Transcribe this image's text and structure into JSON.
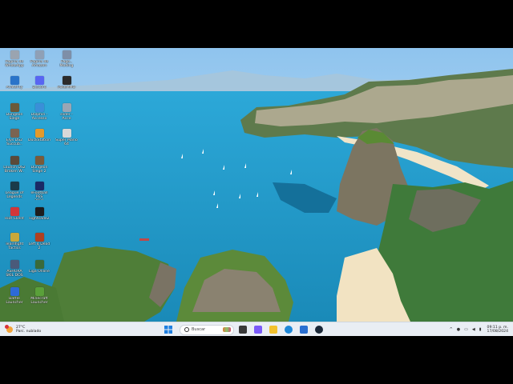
{
  "desktop": {
    "icons": [
      {
        "label": "Pagina de\nWhatsApp",
        "icon": "whatsapp-web-icon",
        "color": "#9aa4b0"
      },
      {
        "label": "Pagina de\nAmazon",
        "icon": "web-shortcut-icon",
        "color": "#8fa0b6"
      },
      {
        "label": "Page..\nModing",
        "icon": "web-shortcut-icon",
        "color": "#7e8fa8"
      },
      {
        "label": "Alice\nSuhi",
        "icon": "web-shortcut-icon",
        "color": "#8f9cb0"
      },
      {
        "label": "Visual Studio\nCode",
        "icon": "vscode-icon",
        "color": "#2a74c9"
      },
      {
        "label": "Mobile\nAccess",
        "icon": "web-shortcut-icon",
        "color": "#8da0b3"
      },
      {
        "label": "Avatarity",
        "icon": "app-icon",
        "color": "#3a6fd1"
      },
      {
        "label": "Discord",
        "icon": "discord-icon",
        "color": "#5865f2"
      },
      {
        "label": "PokeMMO",
        "icon": "pokemmo-icon",
        "color": "#2b2b2b"
      },
      {
        "label": "Dungeon\nSiege",
        "icon": "game-icon",
        "color": "#6a5a3a"
      },
      {
        "label": "Dolphin -\nAccesso",
        "icon": "dolphin-icon",
        "color": "#3a8fd8"
      },
      {
        "label": "slider -\nAcce",
        "icon": "web-shortcut-icon",
        "color": "#9aa6b5"
      },
      {
        "label": "Elys DS2\nSuccub..",
        "icon": "game-icon",
        "color": "#7a6452"
      },
      {
        "label": "DuckStation",
        "icon": "duckstation-icon",
        "color": "#e39a2a"
      },
      {
        "label": "Super Mario\n64",
        "icon": "mario-icon",
        "color": "#d8d8d8"
      },
      {
        "label": "Launch DS2\nBroken W..",
        "icon": "game-icon",
        "color": "#5a4a3a"
      },
      {
        "label": "Dungeon\nSiege 2",
        "icon": "game-icon",
        "color": "#7a5a3a"
      },
      {
        "label": "League of\nLegends",
        "icon": "league-icon",
        "color": "#1a3b4a"
      },
      {
        "label": "eFootball PES\n2021 SEASO..",
        "icon": "efootball-icon",
        "color": "#1a2a66"
      },
      {
        "label": "Riot Client",
        "icon": "riot-icon",
        "color": "#d13639"
      },
      {
        "label": "Fightcade2",
        "icon": "fightcade-icon",
        "color": "#1d1d1d"
      },
      {
        "label": "Teamfight\nTactics",
        "icon": "tft-icon",
        "color": "#c9a83a"
      },
      {
        "label": "Left 4 Dead 2",
        "icon": "l4d2-icon",
        "color": "#b04020"
      },
      {
        "label": "ASHORA\nSKIL DOS",
        "icon": "game-icon",
        "color": "#4a5a7a"
      },
      {
        "label": "Liga Online",
        "icon": "game-icon",
        "color": "#3a6a3a"
      },
      {
        "label": "Battle\nLauncher",
        "icon": "app-icon",
        "color": "#2d6ad8"
      },
      {
        "label": "Minecraft\nLauncher",
        "icon": "minecraft-icon",
        "color": "#5aa03a"
      }
    ]
  },
  "taskbar": {
    "weather": {
      "temp": "27°C",
      "desc": "Parc. nublado",
      "icon": "weather-sun-icon"
    },
    "search_placeholder": "Buscar",
    "apps": [
      {
        "name": "task-view-icon",
        "color": "#3a3a3a"
      },
      {
        "name": "copilot-icon",
        "color": "#7a5af8"
      },
      {
        "name": "file-explorer-icon",
        "color": "#f2c12e"
      },
      {
        "name": "edge-icon",
        "color": "#1e88d8"
      },
      {
        "name": "mail-icon",
        "color": "#2a6fd1"
      },
      {
        "name": "steam-icon",
        "color": "#1b2838"
      }
    ],
    "tray": {
      "chevron": "^",
      "clock_time": "09:11 p. m.",
      "clock_date": "17/08/2024"
    }
  }
}
